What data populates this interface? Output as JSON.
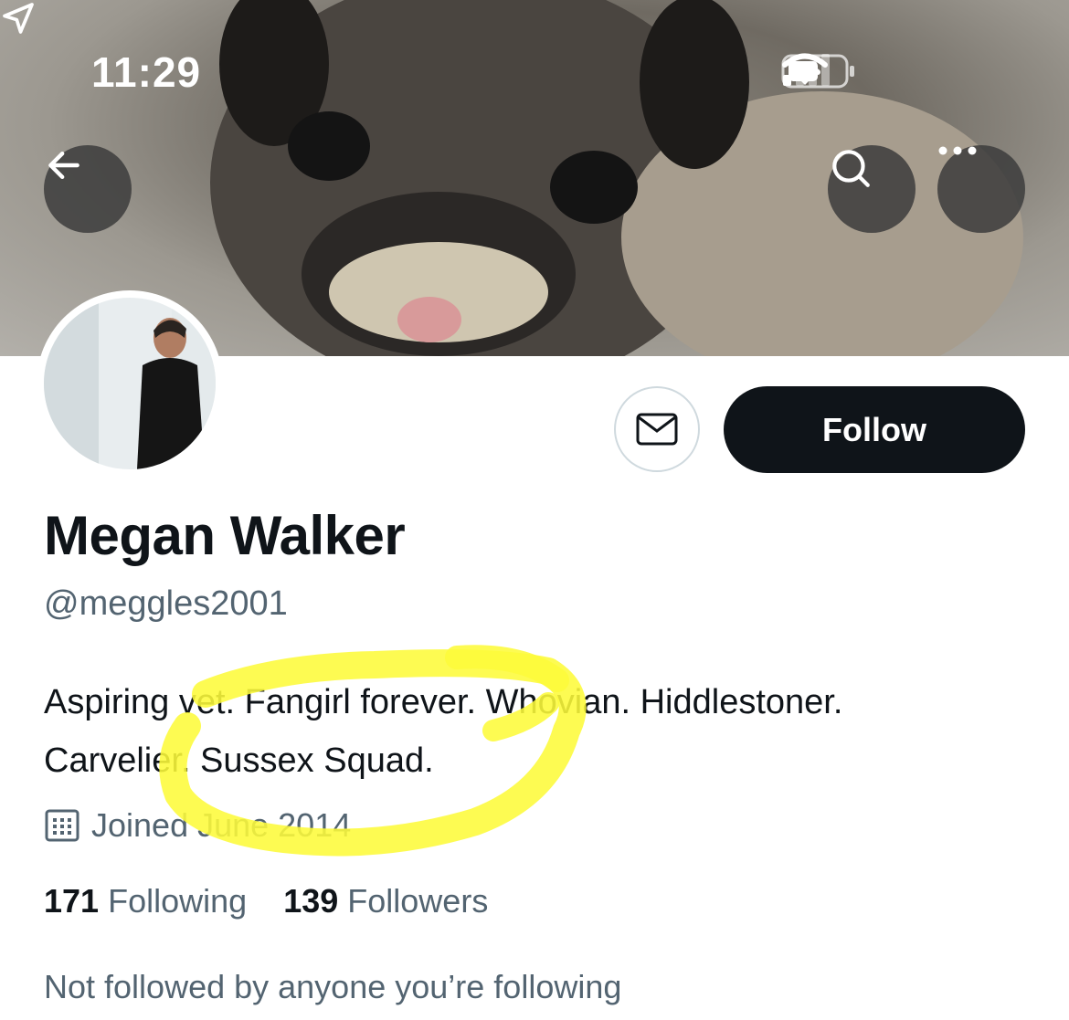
{
  "status_bar": {
    "time": "11:29"
  },
  "nav": {
    "back_icon": "arrow-left-icon",
    "search_icon": "search-icon",
    "more_icon": "more-horizontal-icon"
  },
  "profile": {
    "name": "Megan Walker",
    "handle": "@meggles2001",
    "bio_line1": "Aspiring vet. Fangirl forever. Whovian. Hiddlestoner.",
    "bio_line2": "Carvelier. Sussex Squad.",
    "joined": "Joined June 2014",
    "following_count": "171",
    "following_label": "Following",
    "followers_count": "139",
    "followers_label": "Followers",
    "not_followed": "Not followed by anyone you’re following"
  },
  "actions": {
    "follow_label": "Follow",
    "message_icon": "envelope-icon"
  },
  "colors": {
    "follow_bg": "#0f1419",
    "secondary_text": "#536471",
    "highlight": "#fdfa3a"
  }
}
